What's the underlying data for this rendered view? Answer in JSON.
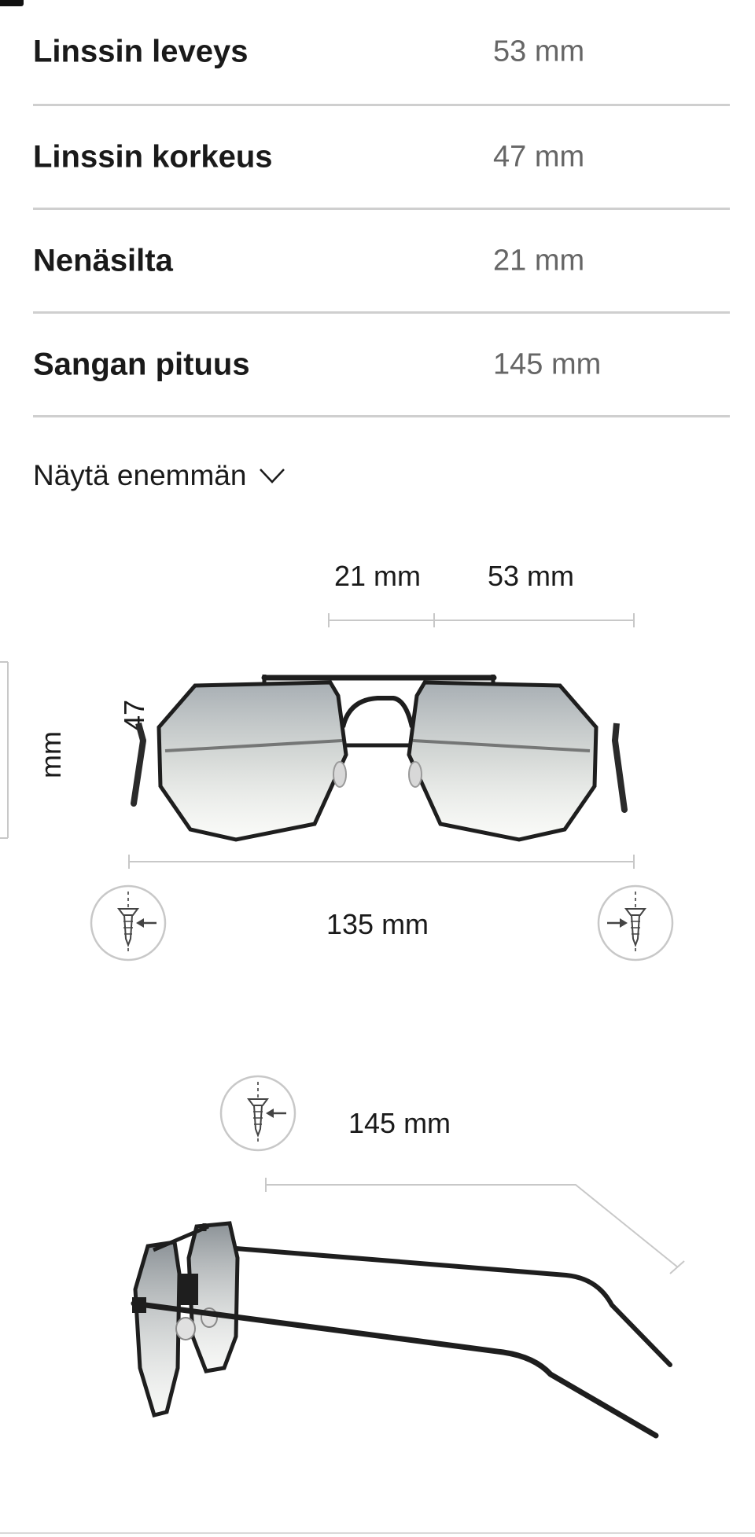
{
  "specs": [
    {
      "label": "Linssin leveys",
      "value": "53 mm"
    },
    {
      "label": "Linssin korkeus",
      "value": "47 mm"
    },
    {
      "label": "Nenäsilta",
      "value": "21 mm"
    },
    {
      "label": "Sangan pituus",
      "value": "145 mm"
    }
  ],
  "show_more": {
    "label": "Näytä enemmän",
    "icon": "chevron-down-icon"
  },
  "front_view": {
    "bridge": "21 mm",
    "lens_width": "53 mm",
    "lens_height_number": "47",
    "lens_height_unit": "mm",
    "total_width": "135 mm",
    "icons": [
      "screw-tighten-icon",
      "screw-tighten-icon"
    ]
  },
  "side_view": {
    "temple_length": "145 mm",
    "icons": [
      "screw-tighten-icon"
    ]
  },
  "colors": {
    "text": "#1a1a1a",
    "muted": "#666666",
    "divider": "#cfcfcf",
    "guide": "#c8c8c8",
    "frame": "#1e1e1e"
  }
}
